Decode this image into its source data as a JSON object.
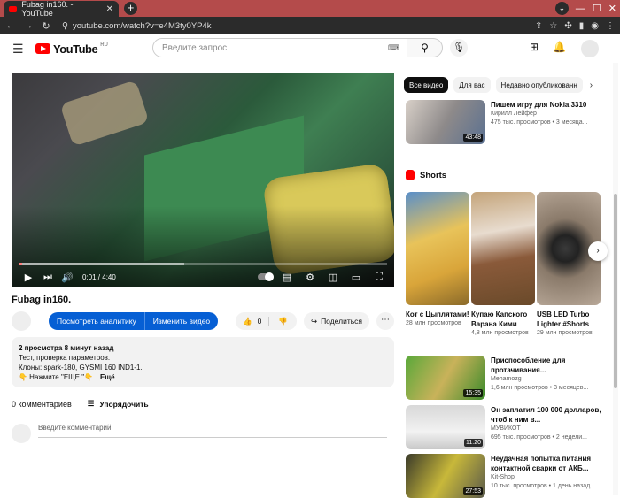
{
  "browser": {
    "tab_title": "Fubag in160. - YouTube",
    "tab_close": "✕",
    "new_tab": "+",
    "url": "youtube.com/watch?v=e4M3ty0YP4k",
    "chevron": "⌄"
  },
  "header": {
    "logo_text": "YouTube",
    "logo_region": "RU",
    "search_placeholder": "Введите запрос"
  },
  "player": {
    "time": "0:01 / 4:40",
    "progress_fraction": 0.004,
    "buffer_fraction": 0.45
  },
  "video": {
    "title": "Fubag in160.",
    "analytics_button": "Посмотреть аналитику",
    "edit_button": "Изменить видео",
    "likes": "0",
    "share_label": "Поделиться",
    "more_glyph": "⋯"
  },
  "description": {
    "meta": "2 просмотра  8 минут назад",
    "line1": "Тест, проверка параметров.",
    "line2": "Клоны: spark-180, GYSMI 160 IND1-1.",
    "line3": "👇 Нажмите \"ЕЩЕ \"👇",
    "more": "Ещё"
  },
  "comments": {
    "count": "0 комментариев",
    "sort": "Упорядочить",
    "placeholder": "Введите комментарий"
  },
  "chips": [
    "Все видео",
    "Для вас",
    "Недавно опубликованн"
  ],
  "recommendations_top": {
    "title": "Пишем игру для Nokia 3310",
    "channel": "Кирилл Лейфер",
    "meta": "475 тыс. просмотров • 3 месяца...",
    "duration": "43:48"
  },
  "shorts": {
    "label": "Shorts",
    "items": [
      {
        "title": "Кот с Цыплятами!",
        "views": "28 млн просмотров"
      },
      {
        "title": "Купаю Капского Варана Кими",
        "views": "4,8 млн просмотров"
      },
      {
        "title": "USB LED Turbo Lighter #Shorts",
        "views": "29 млн просмотров"
      }
    ]
  },
  "recommendations": [
    {
      "title": "Приспособление для протачивания...",
      "channel": "Mehamozg",
      "meta": "1,6 млн просмотров • 3 месяцев...",
      "duration": "15:35"
    },
    {
      "title": "Он заплатил 100 000 долларов, чтоб к ним в...",
      "channel": "МУВИКОТ",
      "meta": "695 тыс. просмотров • 2 недели...",
      "duration": "11:20"
    },
    {
      "title": "Неудачная попытка питания контактной сварки от АКБ...",
      "channel": "Kit-Shop",
      "meta": "10 тыс. просмотров • 1 день назад",
      "duration": "27:53"
    }
  ],
  "colors": {
    "brand_red": "#ff0000",
    "accent_blue": "#065fd4",
    "browser_frame": "#b44b4b"
  }
}
